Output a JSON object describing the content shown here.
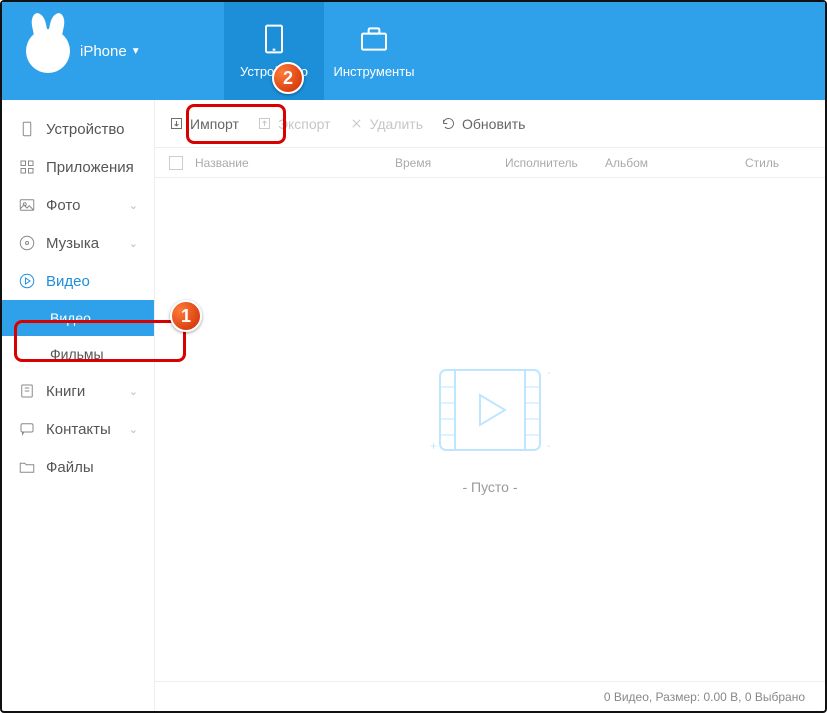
{
  "header": {
    "device_label": "iPhone",
    "tabs": {
      "devices": "Устройство",
      "tools": "Инструменты"
    }
  },
  "sidebar": {
    "device": "Устройство",
    "apps": "Приложения",
    "photo": "Фото",
    "music": "Музыка",
    "video": "Видео",
    "video_sub": "Видео",
    "films_sub": "Фильмы",
    "books": "Книги",
    "contacts": "Контакты",
    "files": "Файлы"
  },
  "toolbar": {
    "import": "Импорт",
    "export": "Экспорт",
    "delete": "Удалить",
    "refresh": "Обновить"
  },
  "columns": {
    "name": "Название",
    "time": "Время",
    "artist": "Исполнитель",
    "album": "Альбом",
    "style": "Стиль"
  },
  "empty_text": "- Пусто -",
  "status": "0 Видео, Размер: 0.00 B, 0 Выбрано",
  "callouts": {
    "one": "1",
    "two": "2"
  }
}
